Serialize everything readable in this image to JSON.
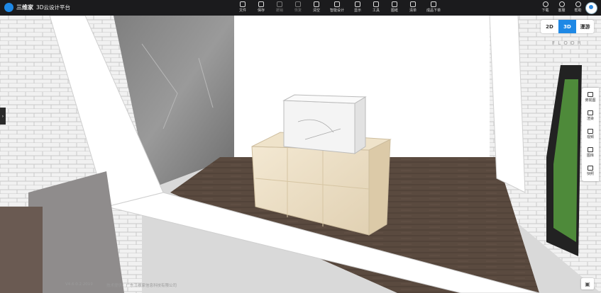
{
  "app": {
    "logo_text": "三维家",
    "platform": "3D云设计平台"
  },
  "toolbar": {
    "items": [
      {
        "label": "文件",
        "icon": "file-icon",
        "enabled": true
      },
      {
        "label": "保存",
        "icon": "save-icon",
        "enabled": true
      },
      {
        "label": "撤销",
        "icon": "undo-icon",
        "enabled": false
      },
      {
        "label": "恢复",
        "icon": "redo-icon",
        "enabled": false
      },
      {
        "label": "清空",
        "icon": "trash-icon",
        "enabled": true
      },
      {
        "label": "智能设计",
        "icon": "smart-design-icon",
        "enabled": true
      },
      {
        "label": "显示",
        "icon": "eye-icon",
        "enabled": true
      },
      {
        "label": "工具",
        "icon": "tools-icon",
        "enabled": true
      },
      {
        "label": "图纸",
        "icon": "drawing-icon",
        "enabled": true
      },
      {
        "label": "清单",
        "icon": "checklist-icon",
        "enabled": true
      },
      {
        "label": "成品下单",
        "icon": "order-icon",
        "enabled": true
      }
    ],
    "right_items": [
      {
        "label": "下载",
        "icon": "download-icon"
      },
      {
        "label": "客服",
        "icon": "service-icon"
      },
      {
        "label": "帮助",
        "icon": "help-icon"
      }
    ]
  },
  "view_modes": [
    {
      "label": "2D",
      "active": false
    },
    {
      "label": "3D",
      "active": true
    },
    {
      "label": "漫游",
      "active": false
    }
  ],
  "compass_text": "F L O O R",
  "side_panel": {
    "items": [
      {
        "label": "俯视图",
        "icon": "top-view-icon"
      },
      {
        "label": "渲染",
        "icon": "camera-icon"
      },
      {
        "label": "视频",
        "icon": "video-icon"
      },
      {
        "label": "图库",
        "icon": "gallery-icon"
      },
      {
        "label": "快照",
        "icon": "snapshot-icon"
      }
    ]
  },
  "footer": {
    "version": "V4.6.0.2.2019",
    "company": "技术提供：广东三维家信息科技有限公司"
  },
  "colors": {
    "topbar": "#1b1b1d",
    "accent": "#1e88e5"
  }
}
